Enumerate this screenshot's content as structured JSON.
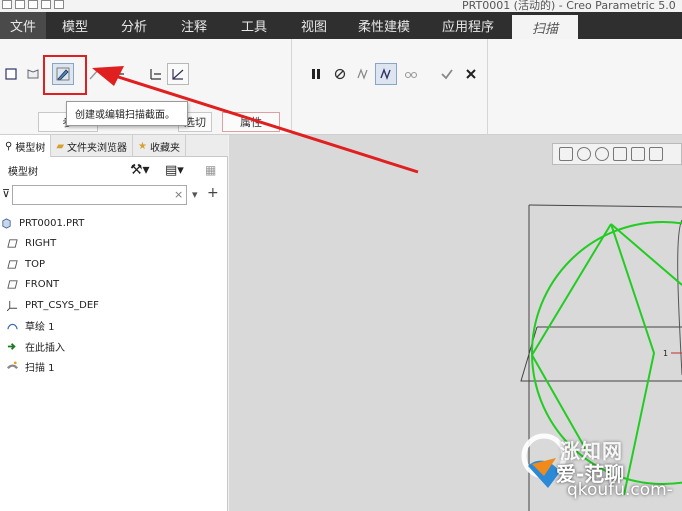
{
  "window": {
    "title": "PRT0001 (活动的) - Creo Parametric 5.0"
  },
  "ribbon_tabs": [
    "文件",
    "模型",
    "分析",
    "注释",
    "工具",
    "视图",
    "柔性建模",
    "应用程序",
    "扫描"
  ],
  "ribbon_subtabs": [
    "参",
    "选切",
    "属性"
  ],
  "tooltip": "创建或编辑扫描截面。",
  "nav_tabs": [
    "模型树",
    "文件夹浏览器",
    "收藏夹"
  ],
  "tree": {
    "header": "模型树",
    "items": [
      {
        "label": "PRT0001.PRT",
        "icon": "part-icon"
      },
      {
        "label": "RIGHT",
        "icon": "datum-plane-icon"
      },
      {
        "label": "TOP",
        "icon": "datum-plane-icon"
      },
      {
        "label": "FRONT",
        "icon": "datum-plane-icon"
      },
      {
        "label": "PRT_CSYS_DEF",
        "icon": "csys-icon"
      },
      {
        "label": "草绘 1",
        "icon": "sketch-icon"
      },
      {
        "label": "在此插入",
        "icon": "insert-arrow-icon"
      },
      {
        "label": "扫描 1",
        "icon": "sweep-icon"
      }
    ]
  },
  "graphics": {
    "dimension_label": "1"
  },
  "watermark": {
    "line1": "涨知网",
    "line2": "爱-范聊",
    "line3": "qkoufu.com-"
  },
  "colors": {
    "accent_red": "#e02020",
    "sketch_green": "#22cc22",
    "tab_bar": "#2f2f2f"
  }
}
